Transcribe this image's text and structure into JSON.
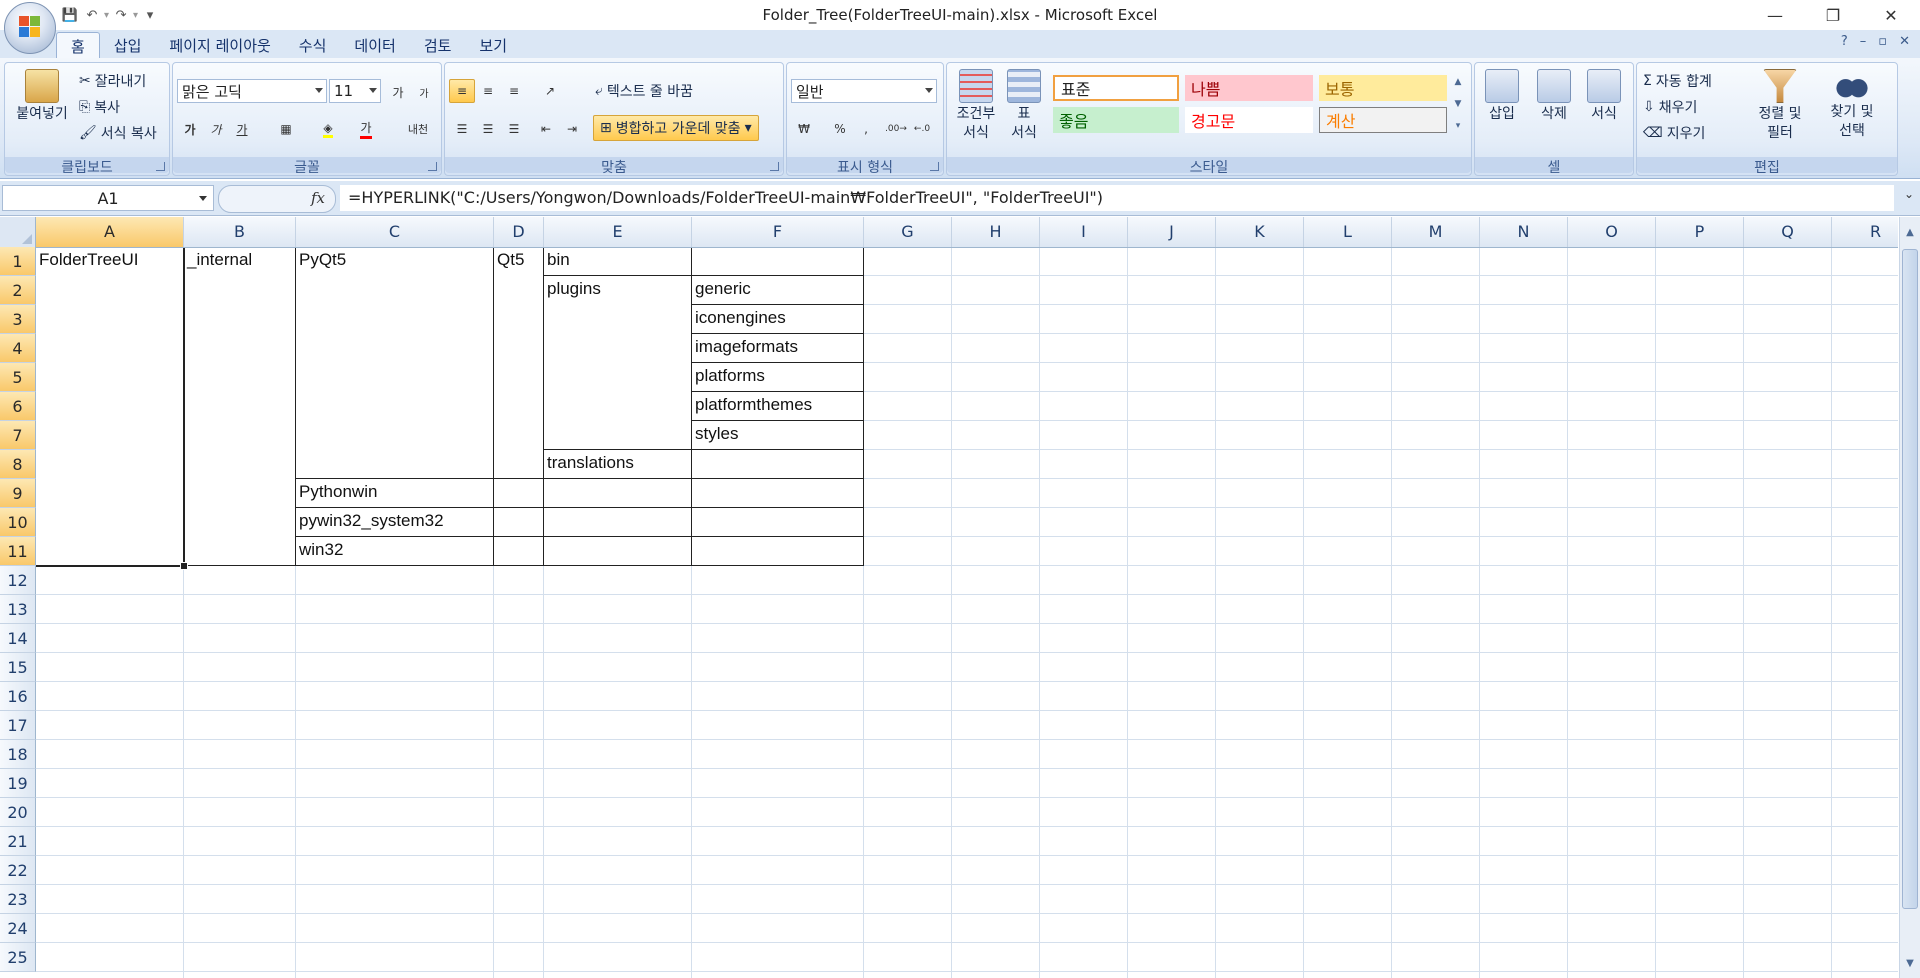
{
  "window": {
    "title": "Folder_Tree(FolderTreeUI-main).xlsx - Microsoft Excel",
    "qat": {
      "save": "💾",
      "undo": "↶",
      "redo": "↷",
      "customize": "▾"
    },
    "controls": {
      "minimize": "—",
      "restore": "❐",
      "close": "✕"
    }
  },
  "ribbon_tabs": [
    "홈",
    "삽입",
    "페이지 레이아웃",
    "수식",
    "데이터",
    "검토",
    "보기"
  ],
  "ribbon": {
    "clipboard": {
      "label": "클립보드",
      "paste": "붙여넣기",
      "cut": "잘라내기",
      "copy": "복사",
      "format_painter": "서식 복사"
    },
    "font": {
      "label": "글꼴",
      "font_name": "맑은 고딕",
      "font_size": "11",
      "grow": "가",
      "shrink": "가",
      "bold": "가",
      "italic": "가",
      "underline": "가",
      "font_color": "가",
      "phonetic": "내천"
    },
    "alignment": {
      "label": "맞춤",
      "wrap_text": "텍스트 줄 바꿈",
      "merge_center": "병합하고 가운데 맞춤"
    },
    "number": {
      "label": "표시 형식",
      "format": "일반",
      "currency": "₩",
      "percent": "%",
      "comma": ","
    },
    "styles": {
      "label": "스타일",
      "conditional_1": "조건부",
      "conditional_2": "서식",
      "table_1": "표",
      "table_2": "서식",
      "normal": "표준",
      "bad": "나쁨",
      "neutral": "보통",
      "good": "좋음",
      "warning": "경고문",
      "calculation": "계산"
    },
    "cells": {
      "label": "셀",
      "insert": "삽입",
      "delete": "삭제",
      "format": "서식"
    },
    "editing": {
      "label": "편집",
      "autosum": "자동 합계",
      "fill": "채우기",
      "clear": "지우기",
      "sort_1": "정렬 및",
      "sort_2": "필터",
      "find_1": "찾기 및",
      "find_2": "선택"
    }
  },
  "formula_bar": {
    "name_box": "A1",
    "fx": "fx",
    "formula": "=HYPERLINK(\"C:/Users/Yongwon/Downloads/FolderTreeUI-main₩FolderTreeUI\", \"FolderTreeUI\")"
  },
  "columns": [
    "A",
    "B",
    "C",
    "D",
    "E",
    "F",
    "G",
    "H",
    "I",
    "J",
    "K",
    "L",
    "M",
    "N",
    "O",
    "P",
    "Q",
    "R"
  ],
  "rows": [
    "1",
    "2",
    "3",
    "4",
    "5",
    "6",
    "7",
    "8",
    "9",
    "10",
    "11",
    "12",
    "13",
    "14",
    "15",
    "16",
    "17",
    "18",
    "19",
    "20",
    "21",
    "22",
    "23",
    "24",
    "25"
  ],
  "cells": {
    "A1": "FolderTreeUI",
    "B1": "_internal",
    "C1": "PyQt5",
    "D1": "Qt5",
    "E1": "bin",
    "E2": "plugins",
    "F2": "generic",
    "F3": "iconengines",
    "F4": "imageformats",
    "F5": "platforms",
    "F6": "platformthemes",
    "F7": "styles",
    "E8": "translations",
    "C9": "Pythonwin",
    "C10": "pywin32_system32",
    "C11": "win32"
  },
  "colors": {
    "selection_header": "#f9c86a",
    "ribbon_bg": "#dde8f6",
    "style_bad_bg": "#ffc7ce",
    "style_bad_fg": "#9c0006",
    "style_neutral_bg": "#ffeb9c",
    "style_neutral_fg": "#9c6500",
    "style_good_bg": "#c6efce",
    "style_good_fg": "#006100",
    "style_warning_fg": "#ff0000",
    "style_calc_fg": "#fa7d00"
  }
}
